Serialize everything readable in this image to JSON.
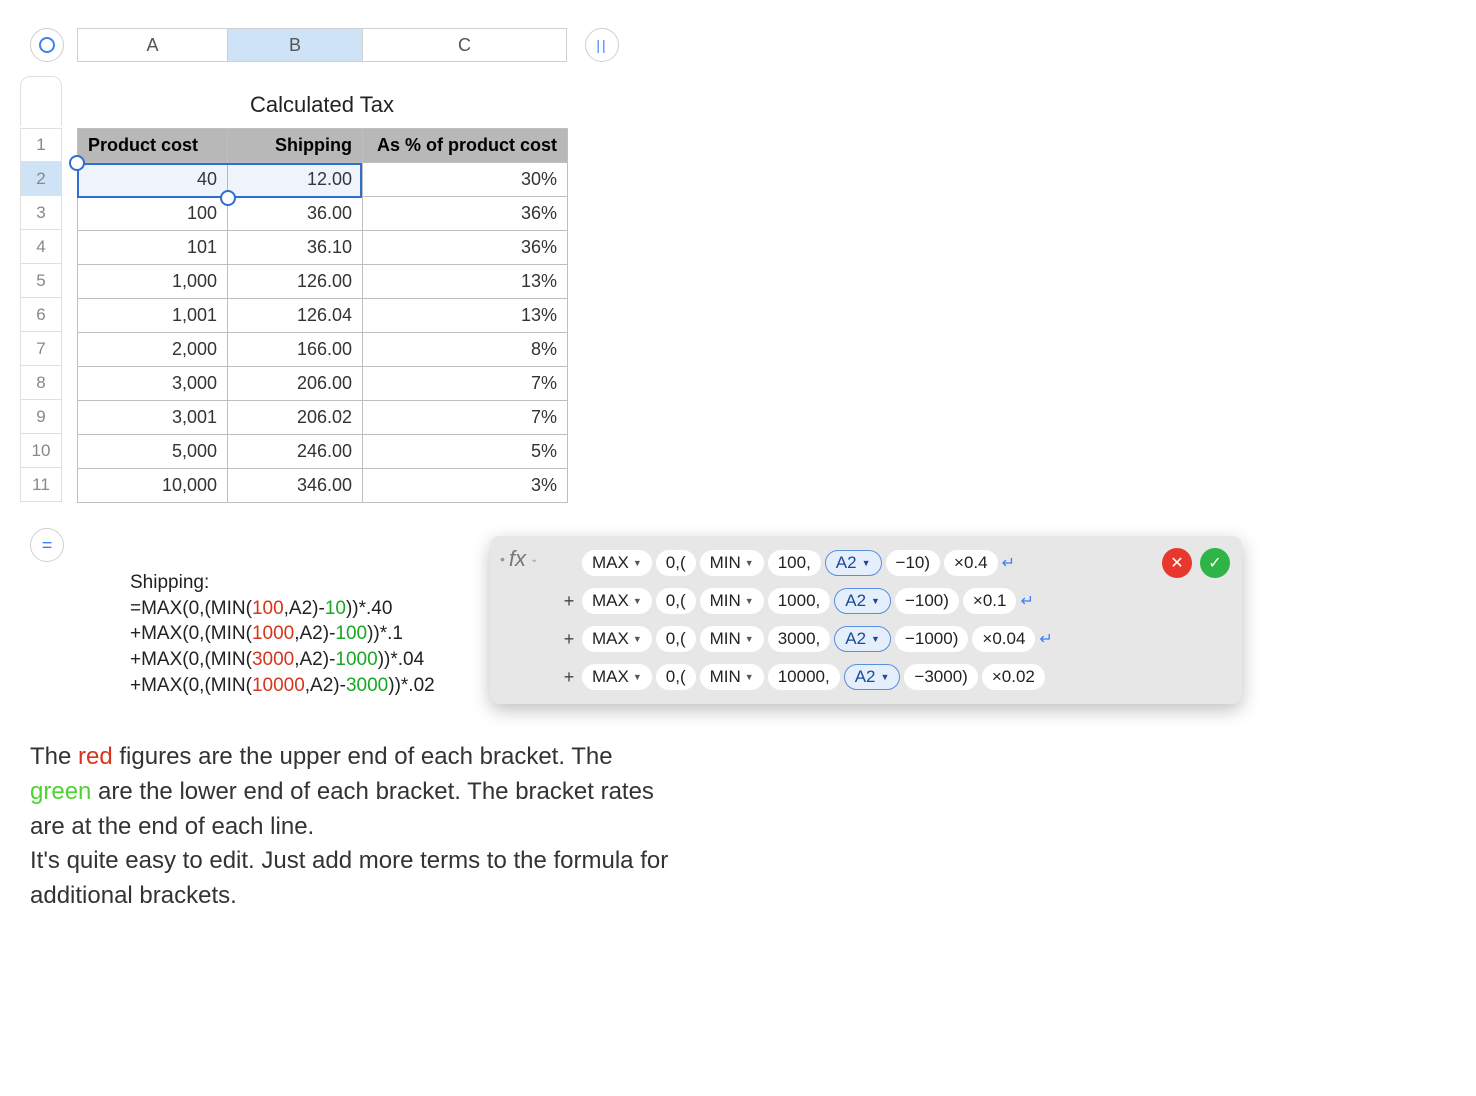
{
  "columns": {
    "a": "A",
    "b": "B",
    "c": "C"
  },
  "tableTitle": "Calculated Tax",
  "headers": {
    "a": "Product cost",
    "b": "Shipping",
    "c": "As % of product cost"
  },
  "rowNums": [
    "1",
    "2",
    "3",
    "4",
    "5",
    "6",
    "7",
    "8",
    "9",
    "10",
    "11"
  ],
  "rows": [
    {
      "a": "40",
      "b": "12.00",
      "c": "30%"
    },
    {
      "a": "100",
      "b": "36.00",
      "c": "36%"
    },
    {
      "a": "101",
      "b": "36.10",
      "c": "36%"
    },
    {
      "a": "1,000",
      "b": "126.00",
      "c": "13%"
    },
    {
      "a": "1,001",
      "b": "126.04",
      "c": "13%"
    },
    {
      "a": "2,000",
      "b": "166.00",
      "c": "8%"
    },
    {
      "a": "3,000",
      "b": "206.00",
      "c": "7%"
    },
    {
      "a": "3,001",
      "b": "206.02",
      "c": "7%"
    },
    {
      "a": "5,000",
      "b": "246.00",
      "c": "5%"
    },
    {
      "a": "10,000",
      "b": "346.00",
      "c": "3%"
    }
  ],
  "formulaText": {
    "title": "Shipping:",
    "lines": [
      {
        "pre": "=MAX(0,(MIN(",
        "red": "100",
        "mid1": ",A2)-",
        "green": "10",
        "mid2": "))*.40"
      },
      {
        "pre": "+MAX(0,(MIN(",
        "red": "1000",
        "mid1": ",A2)-",
        "green": "100",
        "mid2": "))*.1"
      },
      {
        "pre": "+MAX(0,(MIN(",
        "red": "3000",
        "mid1": ",A2)-",
        "green": "1000",
        "mid2": "))*.04"
      },
      {
        "pre": "+MAX(0,(MIN(",
        "red": "10000",
        "mid1": ",A2)-",
        "green": "3000",
        "mid2": "))*.02"
      }
    ]
  },
  "fx": {
    "label": "fx",
    "cellRef": "A2",
    "fnMax": "MAX",
    "fnMin": "MIN",
    "lines": [
      {
        "plus": "",
        "zeroParen": "0,(",
        "upper": "100,",
        "minus": "−10)",
        "rate": "×0.4",
        "ret": true
      },
      {
        "plus": "+",
        "zeroParen": "0,(",
        "upper": "1000,",
        "minus": "−100)",
        "rate": "×0.1",
        "ret": true
      },
      {
        "plus": "+",
        "zeroParen": "0,(",
        "upper": "3000,",
        "minus": "−1000)",
        "rate": "×0.04",
        "ret": true
      },
      {
        "plus": "+",
        "zeroParen": "0,(",
        "upper": "10000,",
        "minus": "−3000)",
        "rate": "×0.02",
        "ret": false
      }
    ]
  },
  "explain": {
    "p1a": "The ",
    "p1_red": "red",
    "p1b": " figures are the upper end of each bracket. The ",
    "p1_green": "green",
    "p1c": " are the lower end of each bracket. The bracket rates are at the end of each line.",
    "p2": "It's quite easy to edit. Just add more terms to the formula for additional brackets."
  },
  "icons": {
    "pause": "||",
    "equals": "=",
    "cancel": "✕",
    "confirm": "✓",
    "dropdown": "▼",
    "chevDown": "⌄",
    "return": "↵",
    "bullet": "•"
  }
}
